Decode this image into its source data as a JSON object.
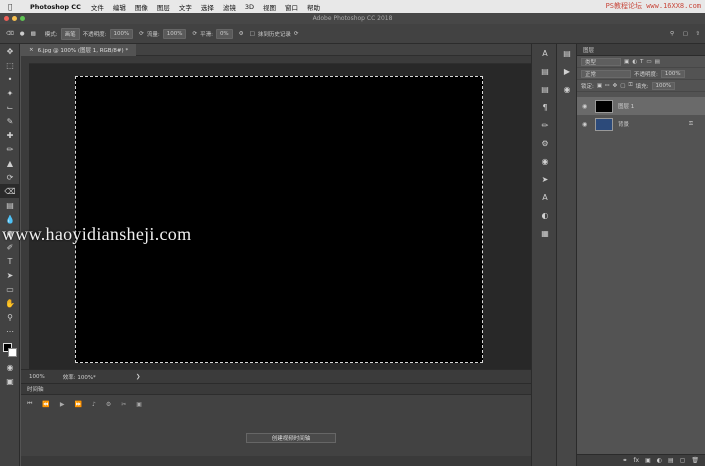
{
  "menubar": {
    "apple": "",
    "app_name": "Photoshop CC",
    "items": [
      "文件",
      "编辑",
      "图像",
      "图层",
      "文字",
      "选择",
      "滤镜",
      "3D",
      "视图",
      "窗口",
      "帮助"
    ],
    "watermark": "PS教程论坛 www.16XX8.com"
  },
  "titlebar": {
    "title": "Adobe Photoshop CC 2018"
  },
  "options": {
    "mode_label": "模式:",
    "mode_value": "画笔",
    "opacity_label": "不透明度:",
    "opacity_value": "100%",
    "flow_label": "流量:",
    "flow_value": "100%",
    "smooth_label": "平滑:",
    "smooth_value": "0%",
    "erase_history_label": "抹到历史记录"
  },
  "document": {
    "tab_label": "6.jpg @ 100% (图层 1, RGB/8#) *",
    "zoom": "100%",
    "status_info": "效率: 100%*",
    "overlay_watermark": "www.haoyidiansheji.com"
  },
  "timeline": {
    "title": "时间轴",
    "create_button": "创建视频时间轴"
  },
  "layers_panel": {
    "title": "图层",
    "filter_label": "类型",
    "blend_mode": "正常",
    "opacity_label": "不透明度:",
    "opacity_value": "100%",
    "lock_label": "锁定:",
    "fill_label": "填充:",
    "fill_value": "100%",
    "layers": [
      {
        "name": "图层 1",
        "thumb_color": "#000000",
        "active": true
      },
      {
        "name": "背景",
        "thumb_color": "#2c4a7a",
        "active": false
      }
    ]
  },
  "colors": {
    "foreground": "#000000",
    "background": "#ffffff",
    "canvas": "#000000"
  }
}
